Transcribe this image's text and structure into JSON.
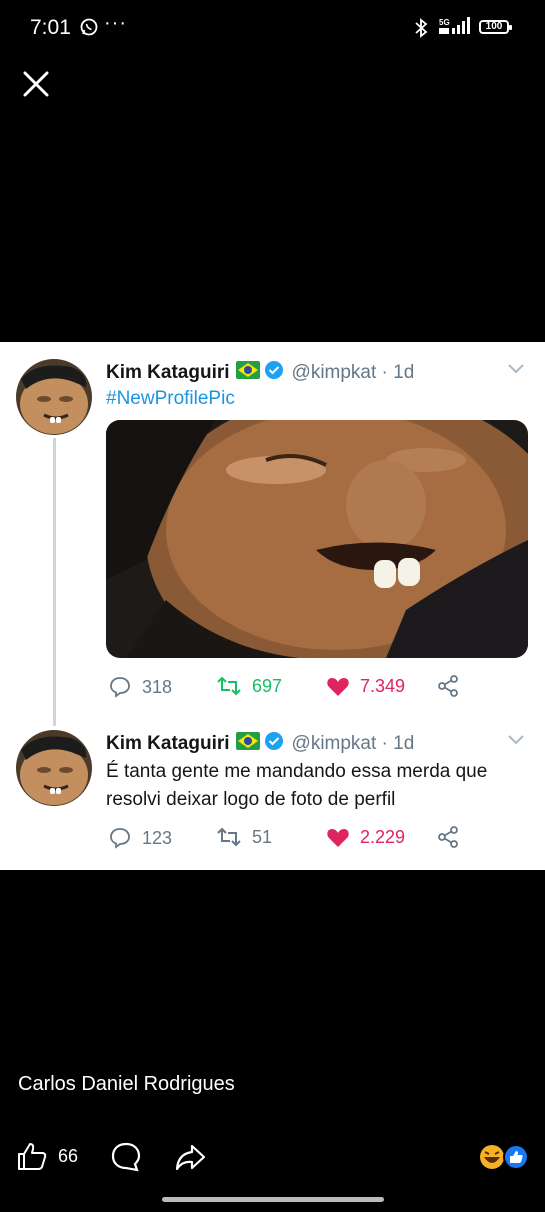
{
  "status_bar": {
    "time": "7:01",
    "network": "5G",
    "battery": "100"
  },
  "viewer": {
    "close_icon": "close-icon"
  },
  "tweets": [
    {
      "name": "Kim Kataguiri",
      "handle": "@kimpkat · 1d",
      "hashtag": "#NewProfilePic",
      "replies": "318",
      "retweets": "697",
      "likes": "7.349"
    },
    {
      "name": "Kim Kataguiri",
      "handle": "@kimpkat · 1d",
      "text": "É tanta gente me mandando essa merda que resolvi deixar logo de foto de perfil",
      "replies": "123",
      "retweets": "51",
      "likes": "2.229"
    }
  ],
  "post": {
    "author": "Carlos Daniel Rodrigues",
    "like_count": "66"
  },
  "colors": {
    "link": "#1b95e0",
    "retweet_active": "#17bf63",
    "like": "#e0245e",
    "muted": "#657786"
  }
}
